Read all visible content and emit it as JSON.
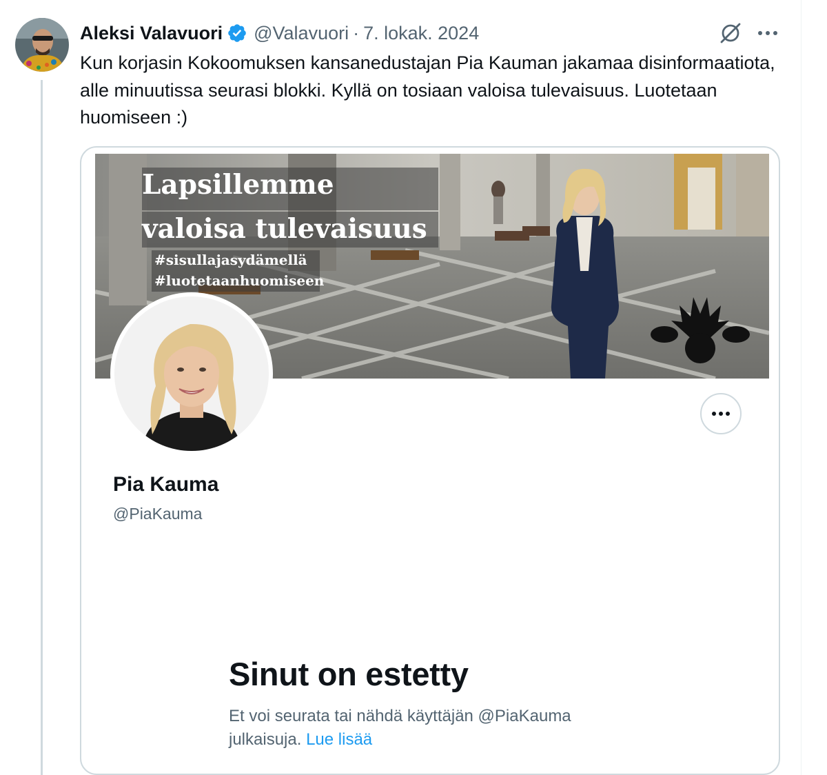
{
  "tweet": {
    "author_name": "Aleksi Valavuori",
    "author_handle": "@Valavuori",
    "separator": "·",
    "date": "7. lokak. 2024",
    "text": "Kun korjasin Kokoomuksen kansanedustajan Pia Kauman jakamaa disinformaatiota, alle minuutissa seurasi blokki. Kyllä on tosiaan valoisa tulevaisuus. Luotetaan huomiseen :)",
    "icons": {
      "verified": "verified-badge-icon",
      "grok": "grok-icon",
      "more": "more-dots-icon"
    }
  },
  "card": {
    "banner": {
      "title_line1": "Lapsillemme",
      "title_line2": "valoisa tulevaisuus",
      "hashtag1": "#sisullajasydämellä",
      "hashtag2": "#luotetaanhuomiseen"
    },
    "profile_name": "Pia Kauma",
    "profile_handle": "@PiaKauma",
    "blocked_title": "Sinut on estetty",
    "blocked_desc": "Et voi seurata tai nähdä käyttäjän @PiaKauma julkaisuja.",
    "blocked_link": "Lue lisää"
  },
  "colors": {
    "text": "#0f1419",
    "secondary": "#536471",
    "link": "#1d9bf0",
    "border": "#cfd9de"
  }
}
